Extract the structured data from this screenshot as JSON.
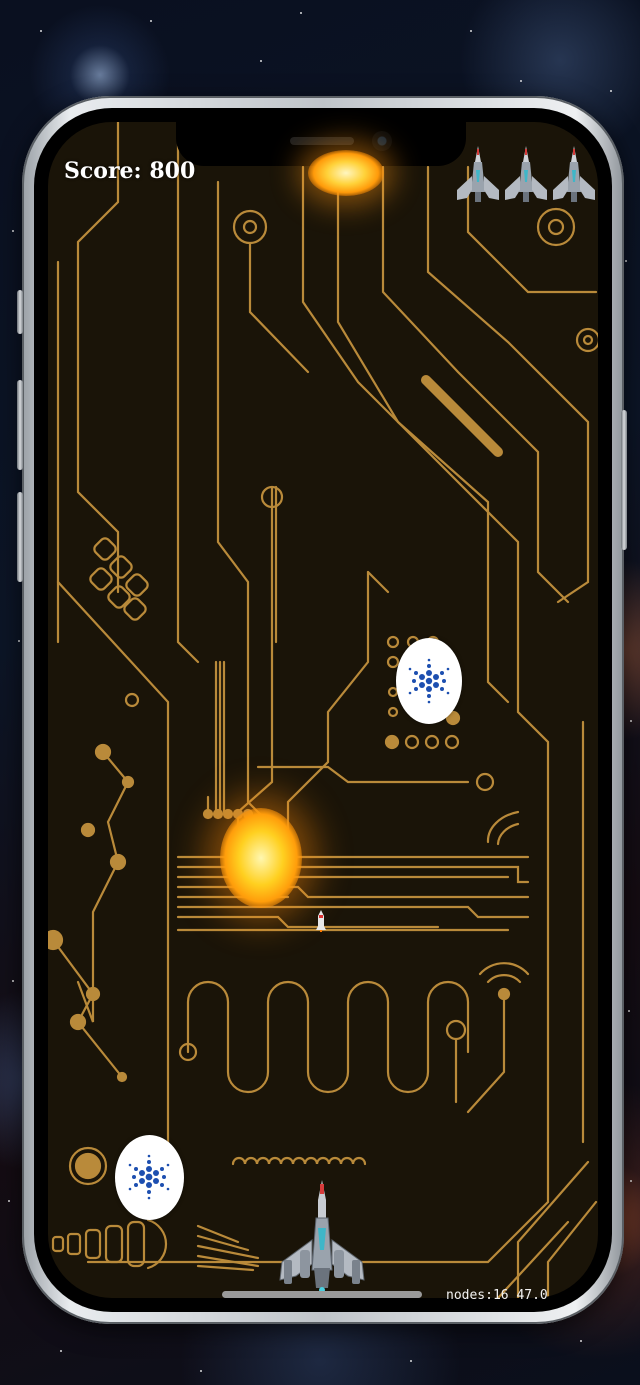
{
  "hud": {
    "score_label": "Score: 800",
    "lives_remaining": 3,
    "debug_stats": "nodes:16  47.0"
  },
  "scene": {
    "background": "circuit-board",
    "circuit_color": "#b98a3a",
    "board_color": "#1a1408",
    "fireballs": 2,
    "coins": 2,
    "coin_icon": "cardano-logo-icon",
    "coin_icon_color": "#1d4fb0",
    "player_icon": "spaceship-icon",
    "projectile_icon": "missile-icon"
  }
}
